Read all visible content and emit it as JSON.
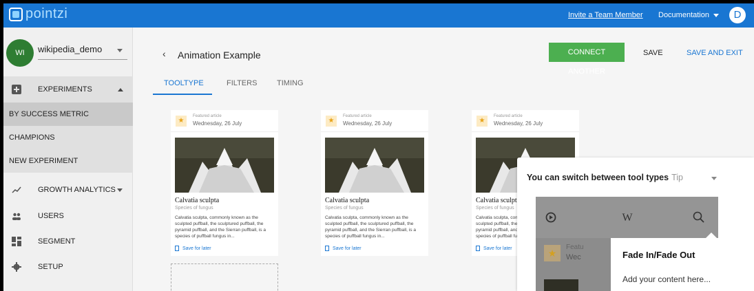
{
  "app": {
    "logo_text": "pointzi",
    "invite_link": "Invite a Team Member",
    "docs_link": "Documentation",
    "user_initial": "D",
    "brand_color": "#1976d2"
  },
  "sidebar": {
    "project_initials": "WI",
    "project_name": "wikipedia_demo",
    "items": [
      {
        "label": "EXPERIMENTS",
        "icon": "plus-box-icon"
      },
      {
        "label": "GROWTH ANALYTICS",
        "icon": "trending-icon"
      },
      {
        "label": "USERS",
        "icon": "users-icon"
      },
      {
        "label": "SEGMENT",
        "icon": "segment-icon"
      },
      {
        "label": "SETUP",
        "icon": "gear-icon"
      }
    ],
    "experiments_sub": [
      "BY SUCCESS METRIC",
      "CHAMPIONS",
      "NEW EXPERIMENT"
    ]
  },
  "header": {
    "back": "‹",
    "title": "Animation Example",
    "connect_label": "CONNECT ANOTHER",
    "save_label": "SAVE",
    "save_exit_label": "SAVE AND EXIT"
  },
  "tabs": [
    "TOOLTYPE",
    "FILTERS",
    "TIMING"
  ],
  "card": {
    "featured": "Featured article",
    "date": "Wednesday, 26 July",
    "title": "Calvatia sculpta",
    "subtitle": "Species of fungus",
    "description": "Calvatia sculpta, commonly known as the sculpted puffball, the sculptured puffball, the pyramid puffball, and the Sierran puffball, is a species of puffball fungus in...",
    "save_later": "Save for later"
  },
  "panel": {
    "title": "You can switch between tool types",
    "tip": "Tip",
    "phone_feat": "Featu",
    "phone_wed": "Wec",
    "tooltip_title": "Fade In/Fade Out",
    "tooltip_body": "Add your content here..."
  }
}
